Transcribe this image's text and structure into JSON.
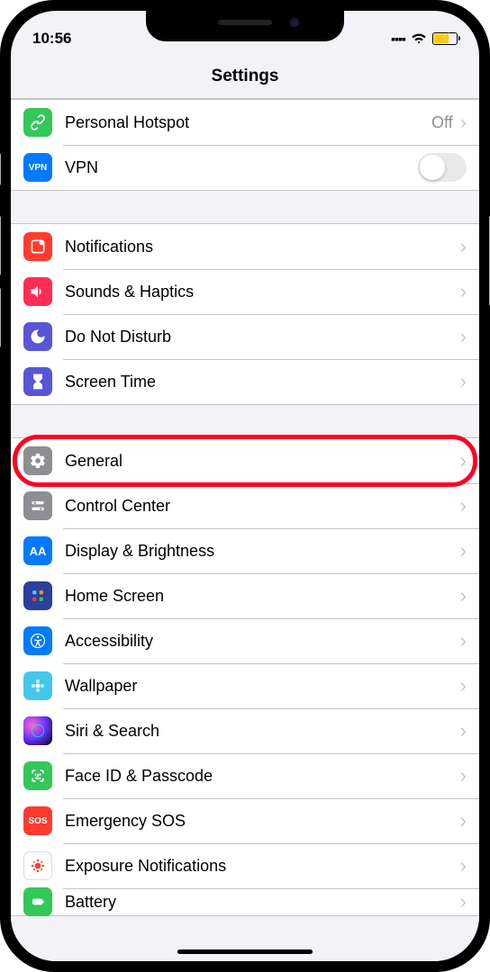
{
  "status": {
    "time": "10:56"
  },
  "header": {
    "title": "Settings"
  },
  "group1": {
    "hotspot": {
      "label": "Personal Hotspot",
      "value": "Off",
      "icon_bg": "#34c759"
    },
    "vpn": {
      "label": "VPN",
      "icon_bg": "#007aff",
      "icon_text": "VPN"
    }
  },
  "group2": {
    "notifications": {
      "label": "Notifications",
      "icon_bg": "#ff3b30"
    },
    "sounds": {
      "label": "Sounds & Haptics",
      "icon_bg": "#ff2d55"
    },
    "dnd": {
      "label": "Do Not Disturb",
      "icon_bg": "#5856d6"
    },
    "screentime": {
      "label": "Screen Time",
      "icon_bg": "#5856d6"
    }
  },
  "group3": {
    "general": {
      "label": "General",
      "icon_bg": "#8e8e93"
    },
    "control": {
      "label": "Control Center",
      "icon_bg": "#8e8e93"
    },
    "display": {
      "label": "Display & Brightness",
      "icon_bg": "#007aff",
      "icon_text": "AA"
    },
    "homescreen": {
      "label": "Home Screen",
      "icon_bg": "#2b3f9b"
    },
    "accessibility": {
      "label": "Accessibility",
      "icon_bg": "#007aff"
    },
    "wallpaper": {
      "label": "Wallpaper",
      "icon_bg": "#44c7ea"
    },
    "siri": {
      "label": "Siri & Search",
      "icon_bg": "#1c1c1e"
    },
    "faceid": {
      "label": "Face ID & Passcode",
      "icon_bg": "#34c759"
    },
    "sos": {
      "label": "Emergency SOS",
      "icon_bg": "#ff3b30",
      "icon_text": "SOS"
    },
    "exposure": {
      "label": "Exposure Notifications",
      "icon_bg": "#ffffff"
    },
    "battery": {
      "label": "Battery",
      "icon_bg": "#34c759"
    }
  }
}
